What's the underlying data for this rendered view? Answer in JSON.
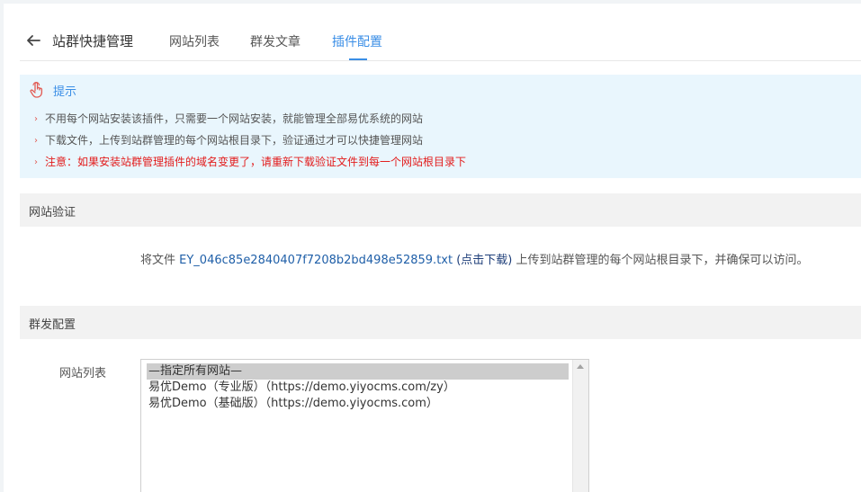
{
  "header": {
    "title": "站群快捷管理",
    "tabs": [
      {
        "label": "网站列表"
      },
      {
        "label": "群发文章"
      },
      {
        "label": "插件配置",
        "active": true
      }
    ]
  },
  "tips": {
    "title": "提示",
    "items": [
      "不用每个网站安装该插件，只需要一个网站安装，就能管理全部易优系统的网站",
      "下载文件，上传到站群管理的每个网站根目录下，验证通过才可以快捷管理网站",
      "注意：如果安装站群管理插件的域名变更了，请重新下载验证文件到每一个网站根目录下"
    ],
    "accent_color": "#3a8ee6",
    "warn_color": "#e21c1c"
  },
  "verify": {
    "section_title": "网站验证",
    "prefix": "将文件",
    "filename": "EY_046c85e2840407f7208b2bd498e52859.txt",
    "download_label": "(点击下载)",
    "suffix": "上传到站群管理的每个网站根目录下，并确保可以访问。"
  },
  "broadcast": {
    "section_title": "群发配置",
    "site_list_label": "网站列表",
    "site_options": [
      "—指定所有网站—",
      "易优Demo（专业版）（https://demo.yiyocms.com/zy）",
      "易优Demo（基础版）（https://demo.yiyocms.com）"
    ],
    "selected_index": 0
  },
  "icons": {
    "back": "arrow-left-icon",
    "tips": "hand-pointer-icon",
    "scroll_up": "scroll-up-arrow-icon"
  }
}
